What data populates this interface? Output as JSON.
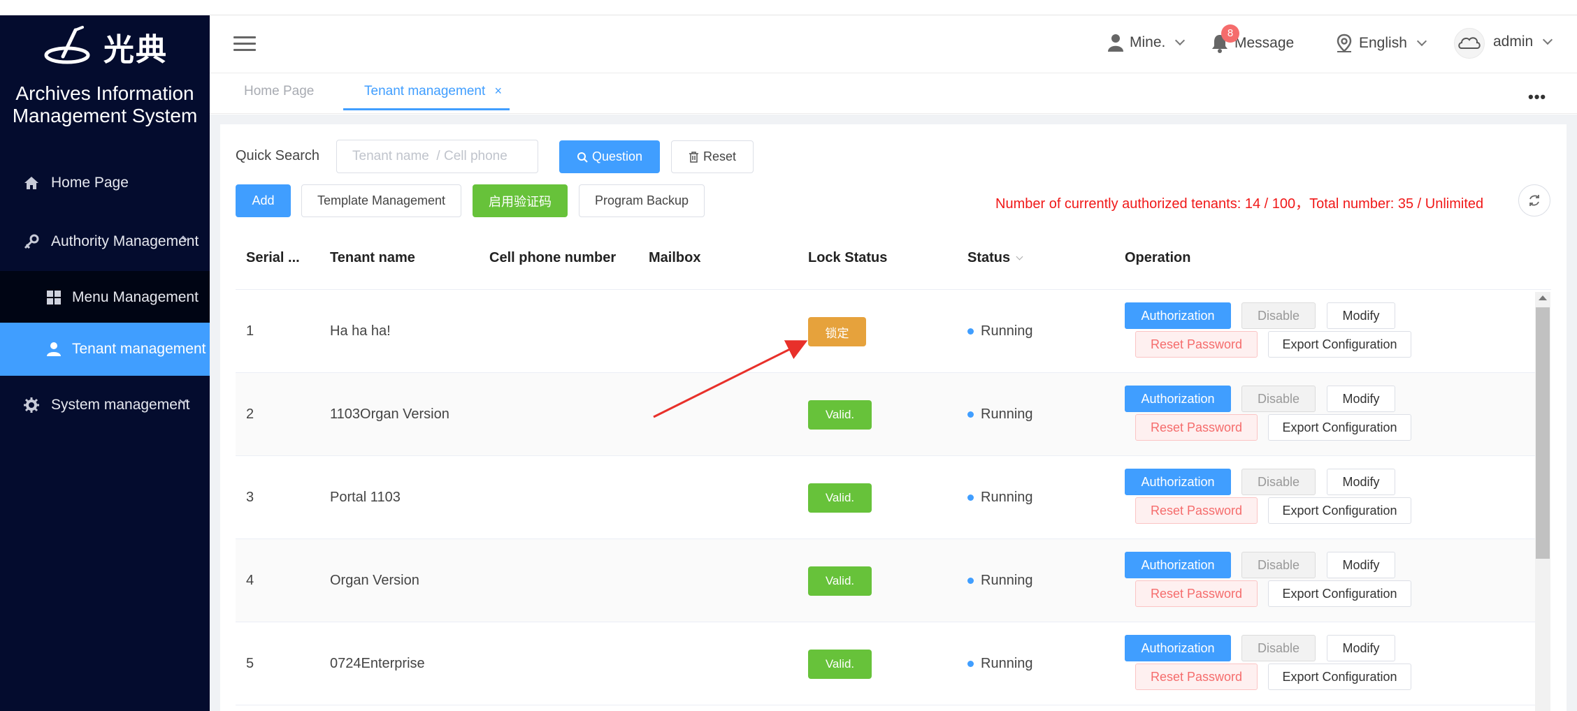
{
  "brand": {
    "logo_text": "光典",
    "system_title_line1": "Archives Information",
    "system_title_line2": "Management System"
  },
  "sidebar": {
    "items": [
      {
        "label": "Home Page",
        "icon": "home-icon"
      },
      {
        "label": "Authority Management",
        "icon": "key-icon"
      },
      {
        "label": "Menu Management",
        "icon": "grid-icon"
      },
      {
        "label": "Tenant management",
        "icon": "user-icon"
      },
      {
        "label": "System management",
        "icon": "gear-icon"
      }
    ]
  },
  "header": {
    "user_label": "Mine.",
    "message_label": "Message",
    "message_count": "8",
    "language_label": "English",
    "admin_label": "admin"
  },
  "tabs": [
    {
      "label": "Home Page"
    },
    {
      "label": "Tenant management",
      "close": "×"
    }
  ],
  "tabs_more": "•••",
  "toolbar": {
    "quick_search_label": "Quick Search",
    "search_placeholder": "Tenant name  / Cell phone",
    "question_label": "Question",
    "reset_label": "Reset",
    "add_label": "Add",
    "template_label": "Template Management",
    "captcha_label": "启用验证码",
    "backup_label": "Program Backup",
    "authorized_info": "Number of currently authorized tenants: 14 / 100，Total number: 35 / Unlimited"
  },
  "table": {
    "headers": [
      "Serial ...",
      "Tenant name",
      "Cell phone number",
      "Mailbox",
      "Lock Status",
      "Status",
      "Operation"
    ],
    "rows": [
      {
        "serial": "1",
        "name": "Ha ha ha!",
        "lock": "锁定",
        "lock_color": "#e6a23c",
        "status": "Running"
      },
      {
        "serial": "2",
        "name": "1103Organ Version",
        "lock": "Valid.",
        "lock_color": "#67c23a",
        "status": "Running"
      },
      {
        "serial": "3",
        "name": "Portal 1103",
        "lock": "Valid.",
        "lock_color": "#67c23a",
        "status": "Running"
      },
      {
        "serial": "4",
        "name": "Organ Version",
        "lock": "Valid.",
        "lock_color": "#67c23a",
        "status": "Running"
      },
      {
        "serial": "5",
        "name": "0724Enterprise",
        "lock": "Valid.",
        "lock_color": "#67c23a",
        "status": "Running"
      }
    ],
    "ops": {
      "authorization": "Authorization",
      "disable": "Disable",
      "modify": "Modify",
      "reset_password": "Reset Password",
      "export": "Export Configuration"
    }
  },
  "colors": {
    "sidebar_bg": "#040c2e",
    "active_nav": "#409eff",
    "primary": "#409eff",
    "success": "#67c23a",
    "warning": "#e6a23c",
    "danger_text": "#f01818",
    "annotation_arrow": "#e8302a"
  }
}
